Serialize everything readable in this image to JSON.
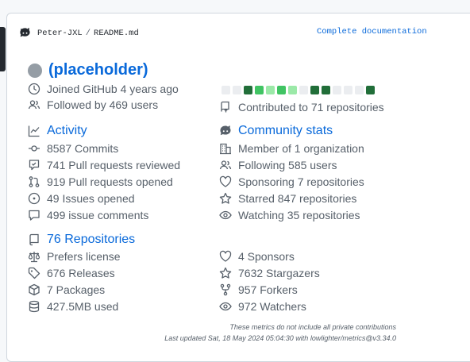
{
  "header": {
    "owner": "Peter-JXL",
    "file": "README.md",
    "separator": "/",
    "doc_link": "Complete documentation"
  },
  "user": {
    "name": "(placeholder)",
    "joined": "Joined GitHub 4 years ago",
    "followers": "Followed by 469 users",
    "contributed": "Contributed to 71 repositories"
  },
  "calendar": {
    "levels": [
      0,
      0,
      3,
      2,
      1,
      2,
      1,
      0,
      3,
      3,
      0,
      0,
      0,
      3
    ],
    "colors": [
      "#ebedf0",
      "#9be9a8",
      "#40c463",
      "#216e39"
    ]
  },
  "activity": {
    "title": "Activity",
    "items": [
      "8587 Commits",
      "741 Pull requests reviewed",
      "919 Pull requests opened",
      "49 Issues opened",
      "499 issue comments"
    ]
  },
  "community": {
    "title": "Community stats",
    "items": [
      "Member of 1 organization",
      "Following 585 users",
      "Sponsoring 7 repositories",
      "Starred 847 repositories",
      "Watching 35 repositories"
    ]
  },
  "repositories": {
    "title": "76 Repositories",
    "left": [
      "Prefers license",
      "676 Releases",
      "7 Packages",
      "427.5MB used"
    ],
    "right": [
      "4 Sponsors",
      "7632 Stargazers",
      "957 Forkers",
      "972 Watchers"
    ]
  },
  "footer": {
    "note": "These metrics do not include all private contributions",
    "updated": "Last updated Sat, 18 May 2024 05:04:30 with lowlighter/metrics@v3.34.0"
  },
  "icons": {
    "header": "octocat-icon",
    "joined": "clock-icon",
    "followers": "people-icon",
    "contributed": "repo-push-icon",
    "activity": "graph-icon",
    "community": "octocat-icon",
    "repositories": "repo-icon"
  }
}
